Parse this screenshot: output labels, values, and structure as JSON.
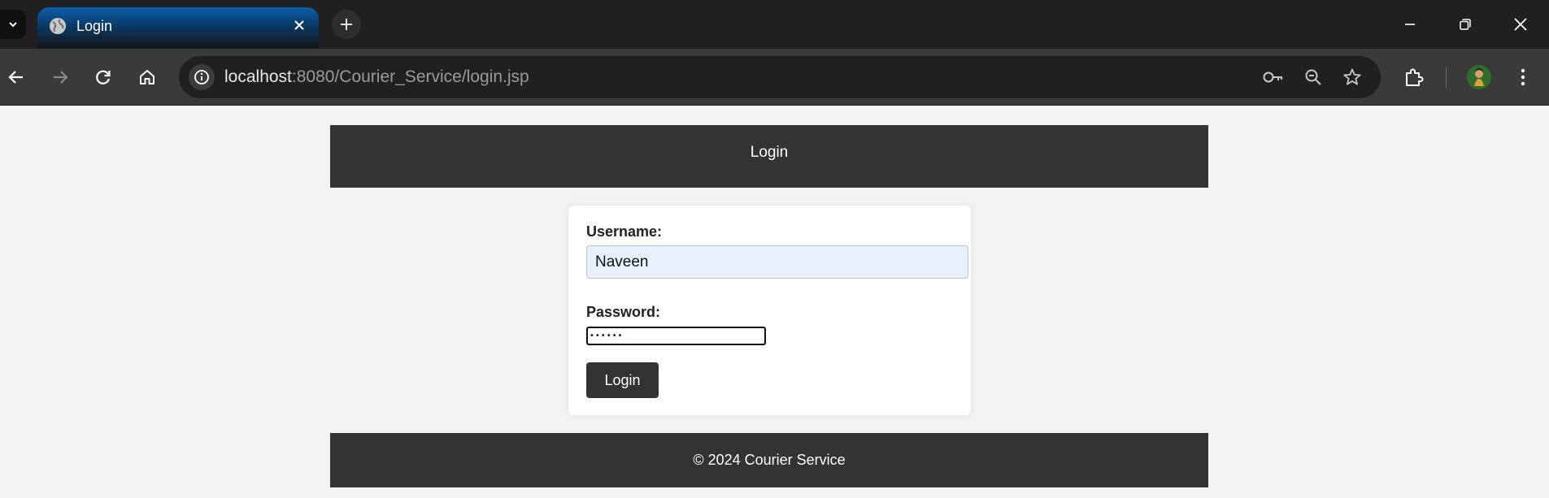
{
  "browser": {
    "tab": {
      "title": "Login",
      "icon": "globe-icon"
    },
    "new_tab_icon": "plus-icon",
    "window_controls": [
      "minimize-icon",
      "restore-icon",
      "close-icon"
    ],
    "address_bar": {
      "host": "localhost",
      "path": ":8080/Courier_Service/login.jsp"
    },
    "toolbar_icons": [
      "back-icon",
      "forward-icon",
      "reload-icon",
      "home-icon",
      "site-info-icon",
      "password-key-icon",
      "zoom-out-icon",
      "bookmark-star-icon",
      "extensions-icon",
      "profile-avatar",
      "menu-icon"
    ]
  },
  "page": {
    "header": {
      "title": "Login"
    },
    "form": {
      "username_label": "Username:",
      "username_value": "Naveen",
      "password_label": "Password:",
      "password_value": "••••••",
      "submit_label": "Login"
    },
    "footer": {
      "text": "© 2024 Courier Service"
    }
  },
  "colors": {
    "header_bg": "#333333",
    "page_bg": "#f3f3f3",
    "autofill_bg": "#e8f0fe",
    "button_bg": "#333333"
  }
}
